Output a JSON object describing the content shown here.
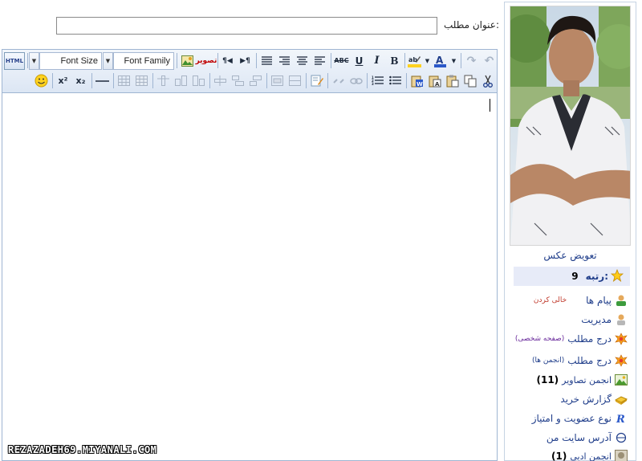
{
  "post_title": {
    "label": "عنوان مطلب:",
    "value": ""
  },
  "editor": {
    "html_button": "HTML",
    "font_size_label": "Font Size",
    "font_family_label": "Font Family",
    "image_button": "تصویر",
    "bold": "B",
    "italic": "I",
    "underline": "U",
    "strike": "ABC",
    "ltr": "¶◀",
    "rtl": "▶¶",
    "superscript": "x²",
    "subscript": "x₂"
  },
  "watermark": "REZAZADEH69.MIYANALI.COM",
  "sidebar": {
    "change_photo": "تعویض عکس",
    "rank_label": "رتبه:",
    "rank_value": "9",
    "messages": {
      "label": "پیام ها",
      "clear": "خالی کردن"
    },
    "management": "مدیریت",
    "post_personal": {
      "label": "درج مطلب",
      "sub": "(صفحه شخصی)"
    },
    "post_forums": {
      "label": "درج مطلب",
      "sub": "(انجمن ها)"
    },
    "photo_forum": {
      "label": "انجمن تصاویر",
      "count": "(11)"
    },
    "purchase_report": "گزارش خرید",
    "membership": "نوع عضویت و امتیاز",
    "site_address": "آدرس سایت من",
    "literary_forum": {
      "label": "انجمن ادبی",
      "count": "(1)"
    }
  },
  "colors": {
    "link_blue": "#1f3d8a",
    "toolbar_border": "#9fb5d2",
    "rank_bg": "#e7ebf8"
  }
}
